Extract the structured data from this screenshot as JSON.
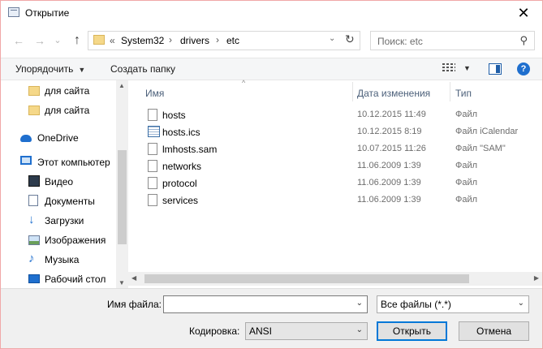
{
  "window": {
    "title": "Открытие",
    "close_glyph": "✕"
  },
  "nav": {
    "back_glyph": "←",
    "forward_glyph": "→",
    "history_glyph": "⌄",
    "up_glyph": "↑",
    "breadcrumb_prefix": "«",
    "breadcrumbs": [
      "System32",
      "drivers",
      "etc"
    ],
    "sep_glyph": "›",
    "dropdown_glyph": "⌄",
    "refresh_glyph": "↻",
    "search_placeholder": "Поиск: etc",
    "search_glyph": "⚲"
  },
  "toolbar": {
    "organize_label": "Упорядочить",
    "new_folder_label": "Создать папку",
    "caret_glyph": "▼",
    "help_glyph": "?"
  },
  "sidebar": {
    "items": [
      {
        "label": "для сайта",
        "icon": "folder-icon"
      },
      {
        "label": "для сайта",
        "icon": "folder-icon"
      },
      {
        "label": "OneDrive",
        "icon": "cloud-icon"
      },
      {
        "label": "Этот компьютер",
        "icon": "computer-icon"
      },
      {
        "label": "Видео",
        "icon": "video-icon"
      },
      {
        "label": "Документы",
        "icon": "documents-icon"
      },
      {
        "label": "Загрузки",
        "icon": "downloads-icon"
      },
      {
        "label": "Изображения",
        "icon": "images-icon"
      },
      {
        "label": "Музыка",
        "icon": "music-icon"
      },
      {
        "label": "Рабочий стол",
        "icon": "desktop-icon"
      }
    ],
    "down_glyph": "↓",
    "music_glyph": "♪"
  },
  "filelist": {
    "columns": {
      "name": "Имя",
      "date": "Дата изменения",
      "type": "Тип"
    },
    "sort_glyph": "^",
    "files": [
      {
        "name": "hosts",
        "date": "10.12.2015 11:49",
        "type": "Файл",
        "icon": "file-icon"
      },
      {
        "name": "hosts.ics",
        "date": "10.12.2015 8:19",
        "type": "Файл iCalendar",
        "icon": "calendar-file-icon"
      },
      {
        "name": "lmhosts.sam",
        "date": "10.07.2015 11:26",
        "type": "Файл \"SAM\"",
        "icon": "file-icon"
      },
      {
        "name": "networks",
        "date": "11.06.2009 1:39",
        "type": "Файл",
        "icon": "file-icon"
      },
      {
        "name": "protocol",
        "date": "11.06.2009 1:39",
        "type": "Файл",
        "icon": "file-icon"
      },
      {
        "name": "services",
        "date": "11.06.2009 1:39",
        "type": "Файл",
        "icon": "file-icon"
      }
    ]
  },
  "scroll": {
    "up": "▲",
    "down": "▼",
    "left": "◀",
    "right": "▶"
  },
  "footer": {
    "filename_label": "Имя файла:",
    "filename_value": "",
    "filetype_value": "Все файлы  (*.*)",
    "encoding_label": "Кодировка:",
    "encoding_value": "ANSI",
    "open_label": "Открыть",
    "cancel_label": "Отмена",
    "dd_glyph": "⌄"
  }
}
